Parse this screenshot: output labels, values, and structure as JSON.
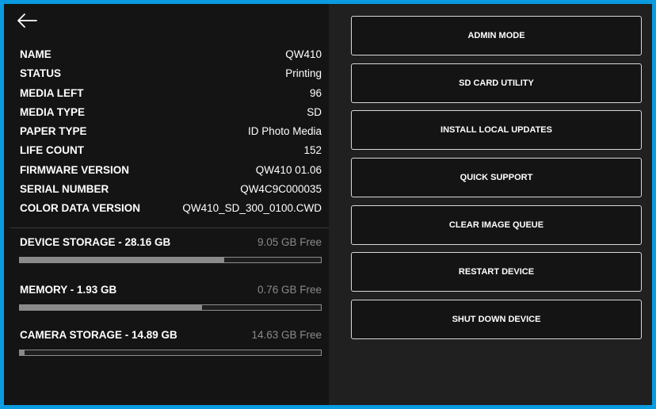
{
  "header": {
    "back_icon": "arrow-left-icon"
  },
  "device_info": [
    {
      "label": "NAME",
      "value": "QW410"
    },
    {
      "label": "STATUS",
      "value": "Printing"
    },
    {
      "label": "MEDIA LEFT",
      "value": "96"
    },
    {
      "label": "MEDIA TYPE",
      "value": "SD"
    },
    {
      "label": "PAPER TYPE",
      "value": "ID Photo Media"
    },
    {
      "label": "LIFE COUNT",
      "value": "152"
    },
    {
      "label": "FIRMWARE VERSION",
      "value": "QW410 01.06"
    },
    {
      "label": "SERIAL NUMBER",
      "value": "QW4C9C000035"
    },
    {
      "label": "COLOR DATA VERSION",
      "value": "QW410_SD_300_0100.CWD"
    }
  ],
  "storage": [
    {
      "title": "DEVICE STORAGE - 28.16 GB",
      "free": "9.05 GB Free",
      "used_fraction": 0.679
    },
    {
      "title": "MEMORY - 1.93 GB",
      "free": "0.76 GB Free",
      "used_fraction": 0.606
    },
    {
      "title": "CAMERA STORAGE - 14.89 GB",
      "free": "14.63 GB Free",
      "used_fraction": 0.017
    }
  ],
  "actions": [
    {
      "label": "ADMIN MODE"
    },
    {
      "label": "SD CARD UTILITY"
    },
    {
      "label": "INSTALL LOCAL UPDATES"
    },
    {
      "label": "QUICK SUPPORT"
    },
    {
      "label": "CLEAR IMAGE QUEUE"
    },
    {
      "label": "RESTART DEVICE"
    },
    {
      "label": "SHUT DOWN DEVICE"
    }
  ],
  "colors": {
    "accent_border": "#0a9be0",
    "left_panel_bg": "#141414",
    "right_panel_bg": "#202020",
    "bar_fill": "#8a8a8a"
  }
}
